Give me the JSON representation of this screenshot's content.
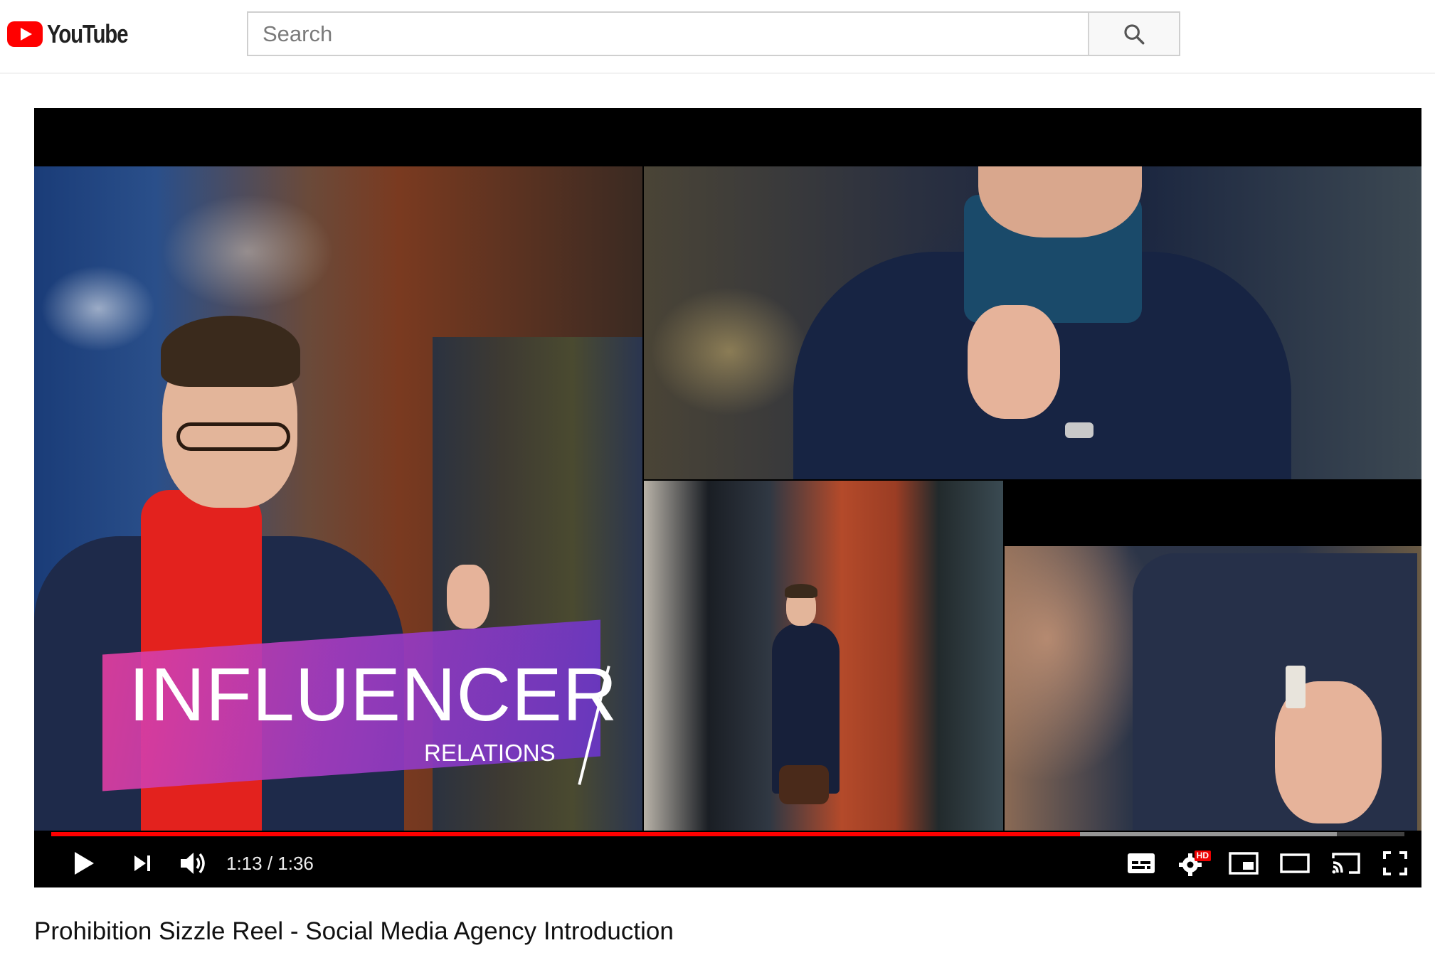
{
  "header": {
    "logo_text": "YouTube",
    "search_placeholder": "Search",
    "search_icon": "search-icon"
  },
  "player": {
    "overlay": {
      "title": "INFLUENCER",
      "subtitle": "RELATIONS"
    },
    "time_display": "1:13 / 1:36",
    "current_time": "1:13",
    "duration": "1:36",
    "progress_fraction": 0.76,
    "buffered_fraction": 0.95,
    "controls": {
      "play_icon": "play-icon",
      "next_icon": "next-icon",
      "volume_icon": "volume-icon",
      "subtitles_icon": "subtitles-icon",
      "settings_icon": "settings-icon",
      "settings_badge": "HD",
      "miniplayer_icon": "miniplayer-icon",
      "theater_icon": "theater-mode-icon",
      "cast_icon": "cast-icon",
      "fullscreen_icon": "fullscreen-icon"
    },
    "colors": {
      "progress": "#ff0000",
      "banner_start": "#e23ea0",
      "banner_end": "#6a36c8"
    }
  },
  "video": {
    "title": "Prohibition Sizzle Reel - Social Media Agency Introduction"
  }
}
